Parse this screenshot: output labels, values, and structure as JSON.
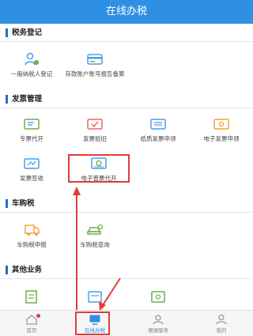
{
  "header": {
    "title": "在线办税"
  },
  "sections": [
    {
      "title": "税务登记",
      "items": [
        {
          "label": "一般纳税人登记",
          "icon": "person-register-icon"
        },
        {
          "label": "存款账户账号报告备案",
          "icon": "bank-card-icon"
        }
      ]
    },
    {
      "title": "发票管理",
      "items": [
        {
          "label": "专票代开",
          "icon": "ticket-icon"
        },
        {
          "label": "发票验旧",
          "icon": "ticket-check-icon"
        },
        {
          "label": "纸质发票申领",
          "icon": "ticket-apply-icon"
        },
        {
          "label": "电子发票申领",
          "icon": "e-ticket-icon"
        },
        {
          "label": "发票签收",
          "icon": "ticket-sign-icon"
        },
        {
          "label": "电子普票代开",
          "icon": "e-invoice-icon"
        }
      ]
    },
    {
      "title": "车购税",
      "items": [
        {
          "label": "车购税申报",
          "icon": "truck-declare-icon"
        },
        {
          "label": "车购税查询",
          "icon": "car-search-icon"
        }
      ]
    },
    {
      "title": "其他业务",
      "items": [
        {
          "label": "",
          "icon": "doc-icon"
        },
        {
          "label": "",
          "icon": "calc-icon"
        },
        {
          "label": "",
          "icon": "form-icon"
        }
      ]
    }
  ],
  "tabbar": {
    "items": [
      {
        "label": "首页",
        "icon": "home-icon",
        "active": false
      },
      {
        "label": "在线办税",
        "icon": "monitor-icon",
        "active": true
      },
      {
        "label": "便捷服务",
        "icon": "service-icon",
        "active": false
      },
      {
        "label": "我的",
        "icon": "user-icon",
        "active": false
      }
    ]
  },
  "colors": {
    "primary": "#2f8fe3",
    "accent": "#e23b3b",
    "icon_blue": "#4a9ee8",
    "icon_green": "#6ab04c",
    "icon_red": "#e56b5d",
    "icon_orange": "#f3a23b"
  }
}
